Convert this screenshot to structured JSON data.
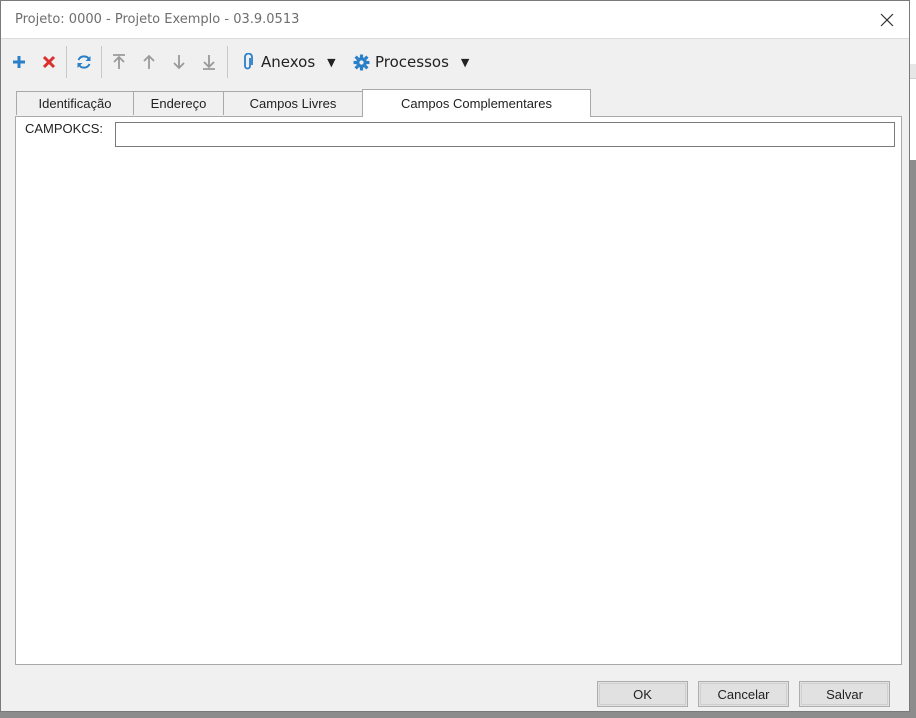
{
  "window": {
    "title": "Projeto: 0000 - Projeto Exemplo - 03.9.0513"
  },
  "toolbar": {
    "icons": {
      "add": "plus-icon",
      "delete": "x-icon",
      "refresh": "refresh-icon",
      "first": "arrow-to-top-icon",
      "up": "arrow-up-icon",
      "down": "arrow-down-icon",
      "last": "arrow-to-bottom-icon",
      "attach": "paperclip-icon",
      "process": "gear-icon"
    },
    "anexos_label": "Anexos",
    "processos_label": "Processos",
    "colors": {
      "add": "#2a7fc9",
      "delete": "#d9302c",
      "refresh": "#2a7fc9",
      "arrows": "#9a9a9a",
      "attach": "#2a7fc9",
      "gear": "#2a7fc9"
    }
  },
  "tabs": [
    {
      "label": "Identificação"
    },
    {
      "label": "Endereço"
    },
    {
      "label": "Campos Livres"
    },
    {
      "label": "Campos Complementares"
    }
  ],
  "active_tab": "Campos Complementares",
  "form": {
    "field_label": "CAMPOKCS:",
    "field_value": ""
  },
  "footer": {
    "ok_label": "OK",
    "cancel_label": "Cancelar",
    "save_label": "Salvar"
  }
}
